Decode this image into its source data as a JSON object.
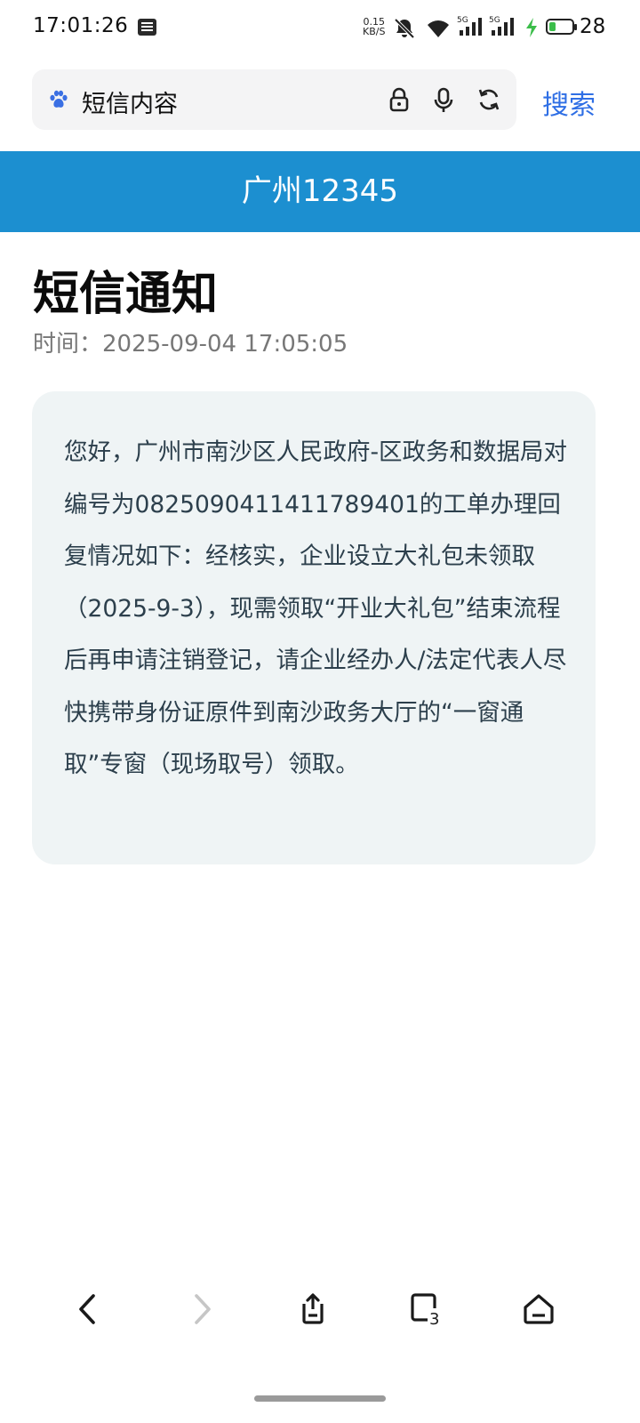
{
  "status_bar": {
    "time": "17:01:26",
    "net_speed_value": "0.15",
    "net_speed_unit": "KB/S",
    "battery_level": "28",
    "battery_fraction": 0.28,
    "signal_1_label": "5G",
    "signal_2_label": "5G",
    "icons": [
      "notification-icon",
      "mute-icon",
      "wifi-icon",
      "signal-icon",
      "charging-icon",
      "battery-icon"
    ]
  },
  "browser": {
    "query": "短信内容",
    "search_label": "搜索",
    "icons": [
      "baidu-paw-icon",
      "lock-icon",
      "mic-icon",
      "refresh-icon"
    ]
  },
  "site": {
    "header_title": "广州12345"
  },
  "page": {
    "title": "短信通知",
    "time_line": "时间：2025-09-04 17:05:05",
    "message": "您好，广州市南沙区人民政府-区政务和数据局对编号为0825090411411789401的工单办理回复情况如下：经核实，企业设立大礼包未领取（2025-9-3），现需领取“开业大礼包”结束流程后再申请注销登记，请企业经办人/法定代表人尽快携带身份证原件到南沙政务大厅的“一窗通取”专窗（现场取号）领取。"
  },
  "bottom_nav": {
    "tab_count": "3",
    "icons": [
      "back-icon",
      "forward-icon",
      "share-icon",
      "tabs-icon",
      "home-icon"
    ]
  },
  "colors": {
    "header_blue": "#1c8fd0",
    "search_blue": "#2f6fe5",
    "card_bg": "#eff4f5",
    "message_text": "#2c3f4c",
    "charging_green": "#3bbd4a"
  }
}
